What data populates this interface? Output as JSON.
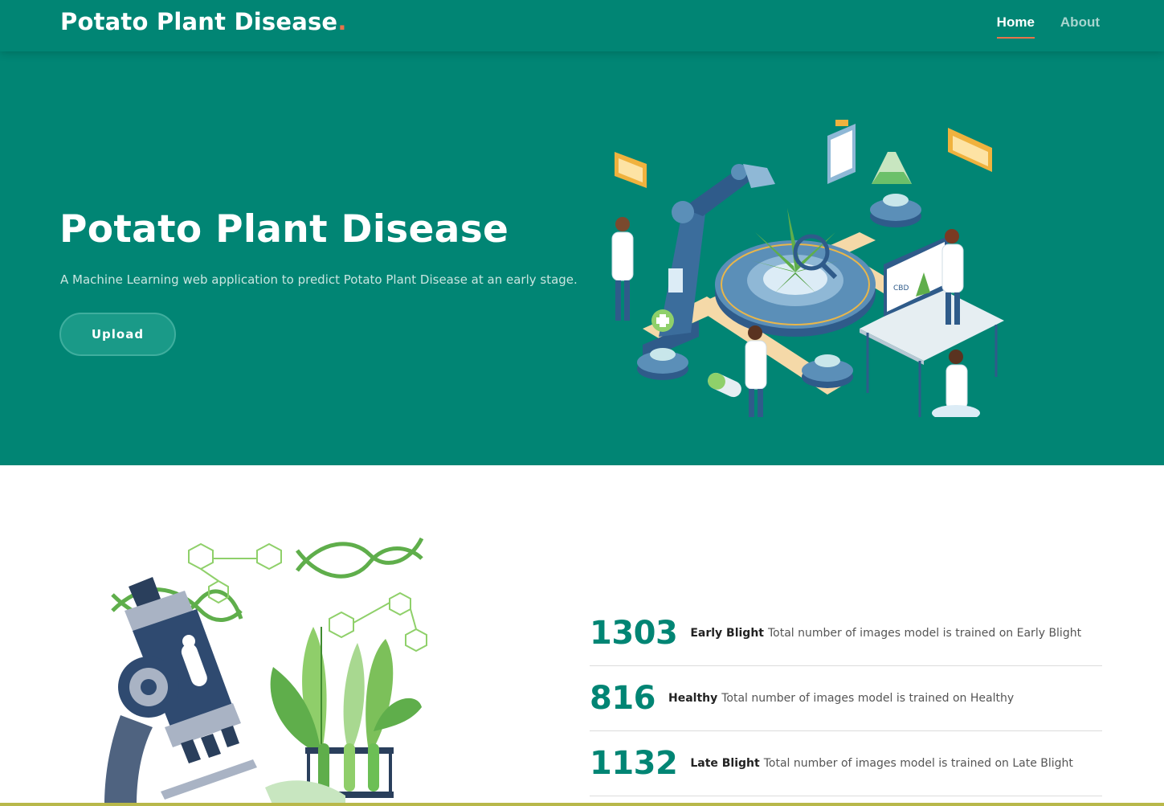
{
  "header": {
    "brand": "Potato Plant Disease",
    "brand_dot": ".",
    "nav": [
      {
        "label": "Home",
        "active": true
      },
      {
        "label": "About",
        "active": false
      }
    ]
  },
  "hero": {
    "title": "Potato Plant Disease",
    "subtitle": "A Machine Learning web application to predict Potato Plant Disease at an early stage.",
    "upload_label": "Upload",
    "illustration_chart_text": "CBD"
  },
  "stats": [
    {
      "value": "1303",
      "label": "Early Blight",
      "description": "Total number of images model is trained on Early Blight"
    },
    {
      "value": "816",
      "label": "Healthy",
      "description": "Total number of images model is trained on Healthy"
    },
    {
      "value": "1132",
      "label": "Late Blight",
      "description": "Total number of images model is trained on Late Blight"
    }
  ],
  "colors": {
    "primary": "#018574",
    "accent": "#e8734a",
    "button": "#1a9a88"
  }
}
